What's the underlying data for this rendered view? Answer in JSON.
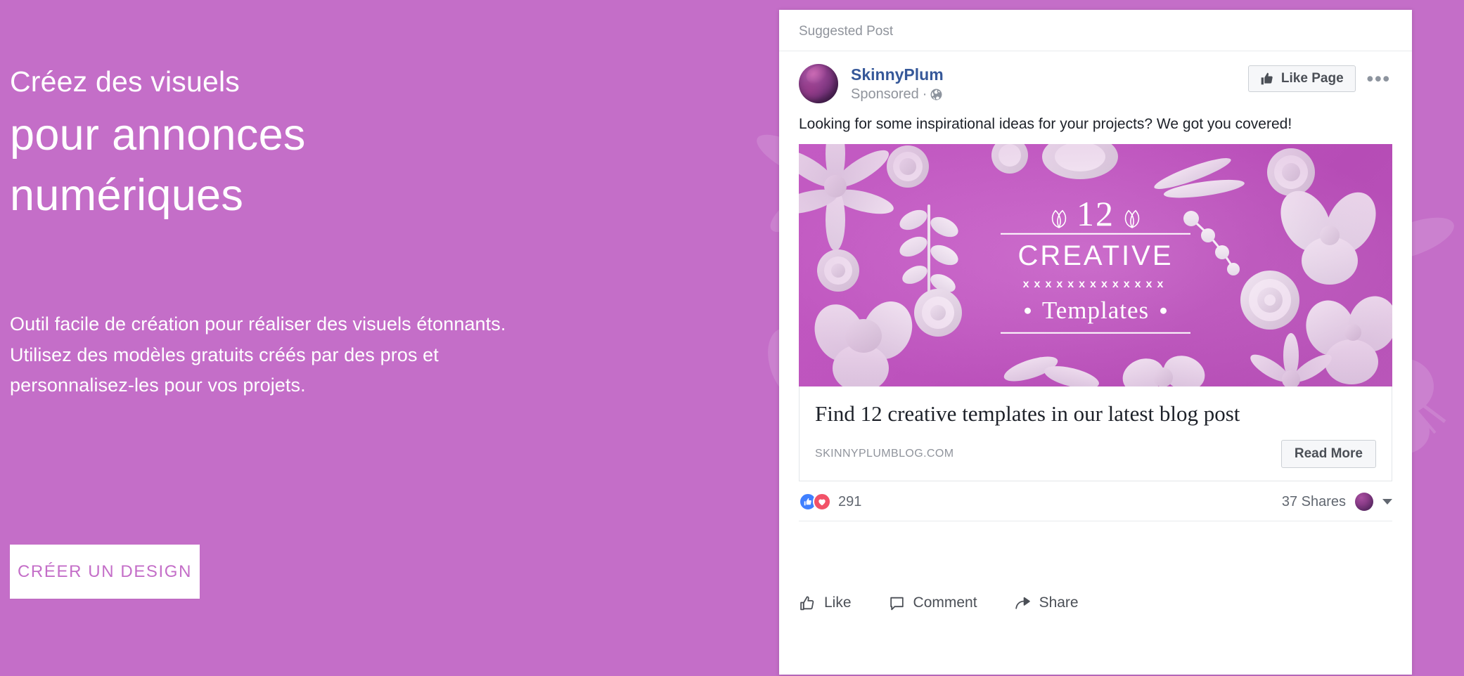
{
  "theme": {
    "background": "#c46ec8",
    "accent": "#c46ec8",
    "card_background": "#ffffff",
    "brand_link_color": "#365899",
    "muted_text": "#90949c",
    "reaction_like": "#4080ff",
    "reaction_love": "#f25268"
  },
  "promo": {
    "headline_small": "Créez des visuels",
    "headline_line1": "pour annonces",
    "headline_line2": "numériques",
    "sub_line1": "Outil facile de création pour réaliser des visuels étonnants.",
    "sub_line2": "Utilisez des modèles gratuits créés par des pros et",
    "sub_line3": "personnalisez-les pour vos projets.",
    "cta_label": "CRÉER UN DESIGN"
  },
  "post": {
    "suggested_label": "Suggested Post",
    "page_name": "SkinnyPlum",
    "sponsored_label": "Sponsored",
    "sponsored_separator": "·",
    "audience_icon": "globe-icon",
    "avatar_icon": "plum-avatar",
    "like_page_label": "Like Page",
    "like_page_icon": "thumbs-up-solid-icon",
    "more_options_label": "•••",
    "body_text": "Looking for some inspirational ideas for your projects? We got you covered!",
    "ad_image": {
      "icon": "paper-flowers-image",
      "number": "12",
      "headline": "CREATIVE",
      "divider_pattern": "xxxxxxxxxxxxx",
      "subhead": "Templates",
      "background_color": "#c85fc8"
    },
    "link_preview": {
      "title": "Find 12 creative templates in our latest blog post",
      "domain": "SKINNYPLUMBLOG.COM",
      "button_label": "Read More"
    },
    "engagement": {
      "reaction_icons": [
        "thumbs-up-icon",
        "heart-icon"
      ],
      "reaction_count": "291",
      "shares": "37 Shares",
      "viewer_avatar_icon": "plum-avatar-small",
      "audience_caret_icon": "caret-down-icon"
    },
    "actions": [
      {
        "label": "Like",
        "icon": "thumbs-up-outline-icon"
      },
      {
        "label": "Comment",
        "icon": "comment-bubble-icon"
      },
      {
        "label": "Share",
        "icon": "share-arrow-icon"
      }
    ]
  }
}
